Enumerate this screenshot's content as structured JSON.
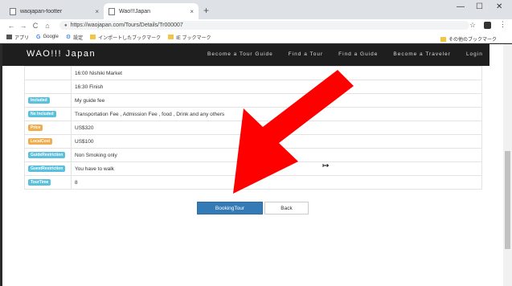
{
  "browser": {
    "tabs": [
      {
        "label": "waojapan-footter",
        "close": "×"
      },
      {
        "label": "Wao!!!Japan",
        "close": "×"
      }
    ],
    "new_tab": "+",
    "window_controls": {
      "minimize": "—",
      "maximize": "☐",
      "close": "✕"
    },
    "nav": {
      "back": "←",
      "forward": "→",
      "reload": "C",
      "home": "⌂"
    },
    "url": "https://waojapan.com/Tours/Details/Tr000007",
    "star": "☆",
    "menu": "⋮",
    "bookmarks": [
      {
        "label": "アプリ",
        "icon": "apps-grid-icon"
      },
      {
        "label": "Google",
        "icon": "google-icon"
      },
      {
        "label": "設定",
        "icon": "gear-icon"
      },
      {
        "label": "インポートしたブックマーク",
        "icon": "folder-icon"
      },
      {
        "label": "IE ブックマーク",
        "icon": "folder-icon"
      }
    ],
    "other_bookmarks": "その他のブックマーク"
  },
  "site": {
    "brand": "WAO!!! Japan",
    "nav": [
      "Become a Tour Guide",
      "Find a Tour",
      "Find a Guide",
      "Become a Traveler",
      "Login"
    ]
  },
  "schedule": [
    "16:00 Nishiki Market",
    "16:30 Finish"
  ],
  "details": [
    {
      "label": "Included",
      "value": "My guide fee",
      "color": "blue"
    },
    {
      "label": "No Included",
      "value": "Transportation Fee , Admission Fee , food , Drink and any others",
      "color": "blue"
    },
    {
      "label": "Price",
      "value": "US$320",
      "color": "orange"
    },
    {
      "label": "LocalCost",
      "value": "US$100",
      "color": "orange"
    },
    {
      "label": "GuideRestriction",
      "value": "Non Smoking only",
      "color": "blue"
    },
    {
      "label": "GuestRestriction",
      "value": "You have to walk",
      "color": "blue"
    },
    {
      "label": "TourTime",
      "value": "8",
      "color": "blue"
    }
  ],
  "buttons": {
    "booking": "BookingTour",
    "back": "Back"
  },
  "colors": {
    "badge_blue": "#5bc0de",
    "badge_orange": "#f0ad4e",
    "primary": "#337ab7",
    "arrow": "#ff0000",
    "nav_bg": "#1e1e1e"
  }
}
